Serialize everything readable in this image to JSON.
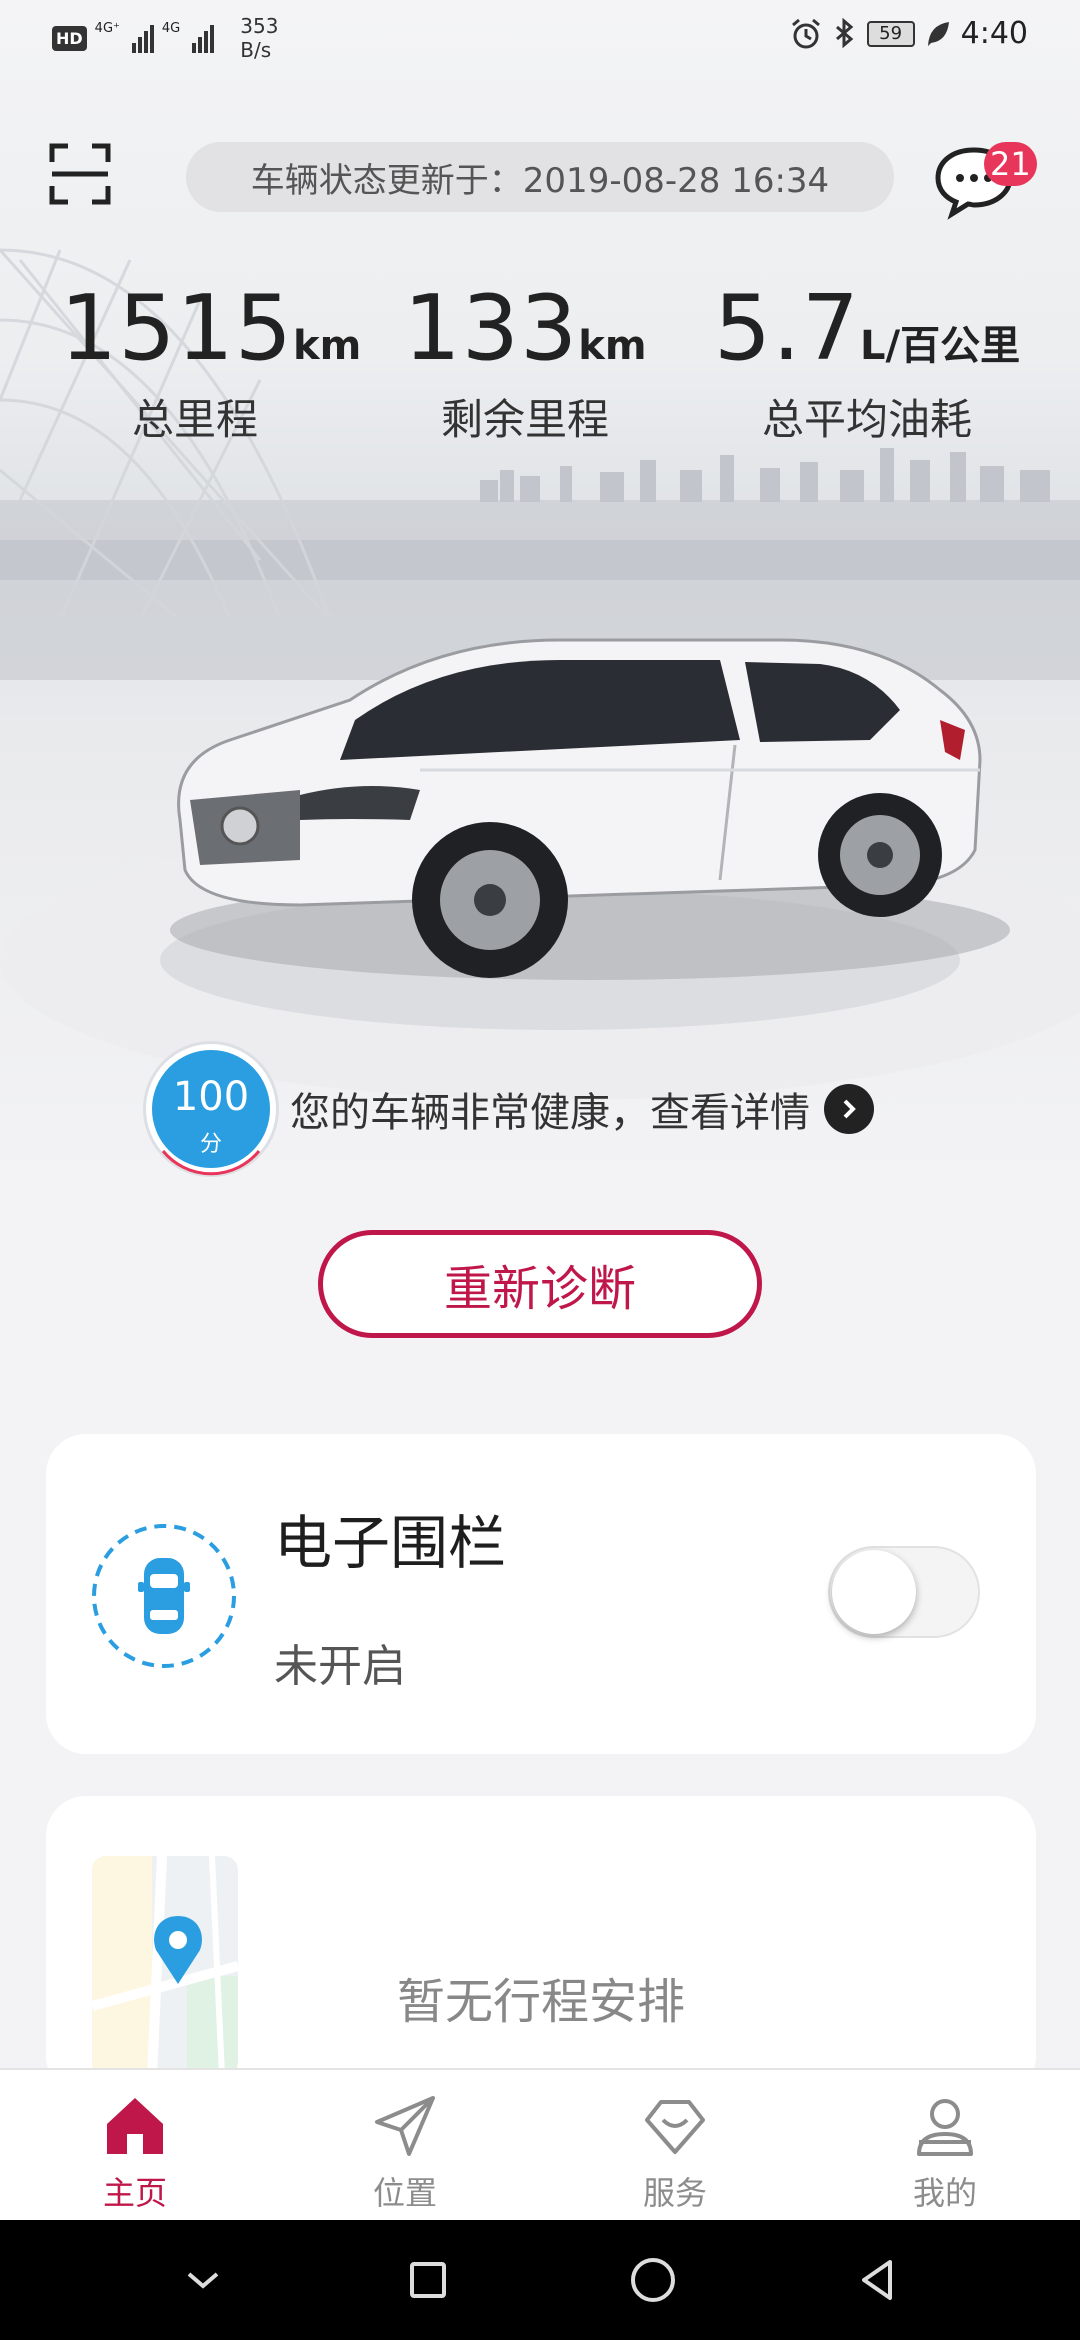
{
  "status_bar": {
    "hd": "HD",
    "sig1_tag": "4G⁺",
    "sig2_tag": "4G",
    "net_speed_value": "353",
    "net_speed_unit": "B/s",
    "battery": "59",
    "time": "4:40"
  },
  "header": {
    "update_text": "车辆状态更新于：2019-08-28 16:34",
    "message_badge": "21"
  },
  "stats": [
    {
      "value": "1515",
      "unit": "km",
      "label": "总里程"
    },
    {
      "value": "133",
      "unit": "km",
      "label": "剩余里程"
    },
    {
      "value": "5.7",
      "unit": "L/百公里",
      "label": "总平均油耗"
    }
  ],
  "health": {
    "score": "100",
    "score_unit": "分",
    "text": "您的车辆非常健康，查看详情"
  },
  "rediagnose_label": "重新诊断",
  "fence_card": {
    "title": "电子围栏",
    "status": "未开启",
    "toggle_on": false
  },
  "trip_card": {
    "text": "暂无行程安排"
  },
  "bottom_nav": [
    {
      "label": "主页",
      "icon": "home-icon",
      "active": true
    },
    {
      "label": "位置",
      "icon": "navigation-arrow-icon",
      "active": false
    },
    {
      "label": "服务",
      "icon": "service-diamond-icon",
      "active": false
    },
    {
      "label": "我的",
      "icon": "user-icon",
      "active": false
    }
  ],
  "colors": {
    "brand": "#c0174a",
    "badge": "#e8355a",
    "score_blue": "#2a9ee0"
  }
}
